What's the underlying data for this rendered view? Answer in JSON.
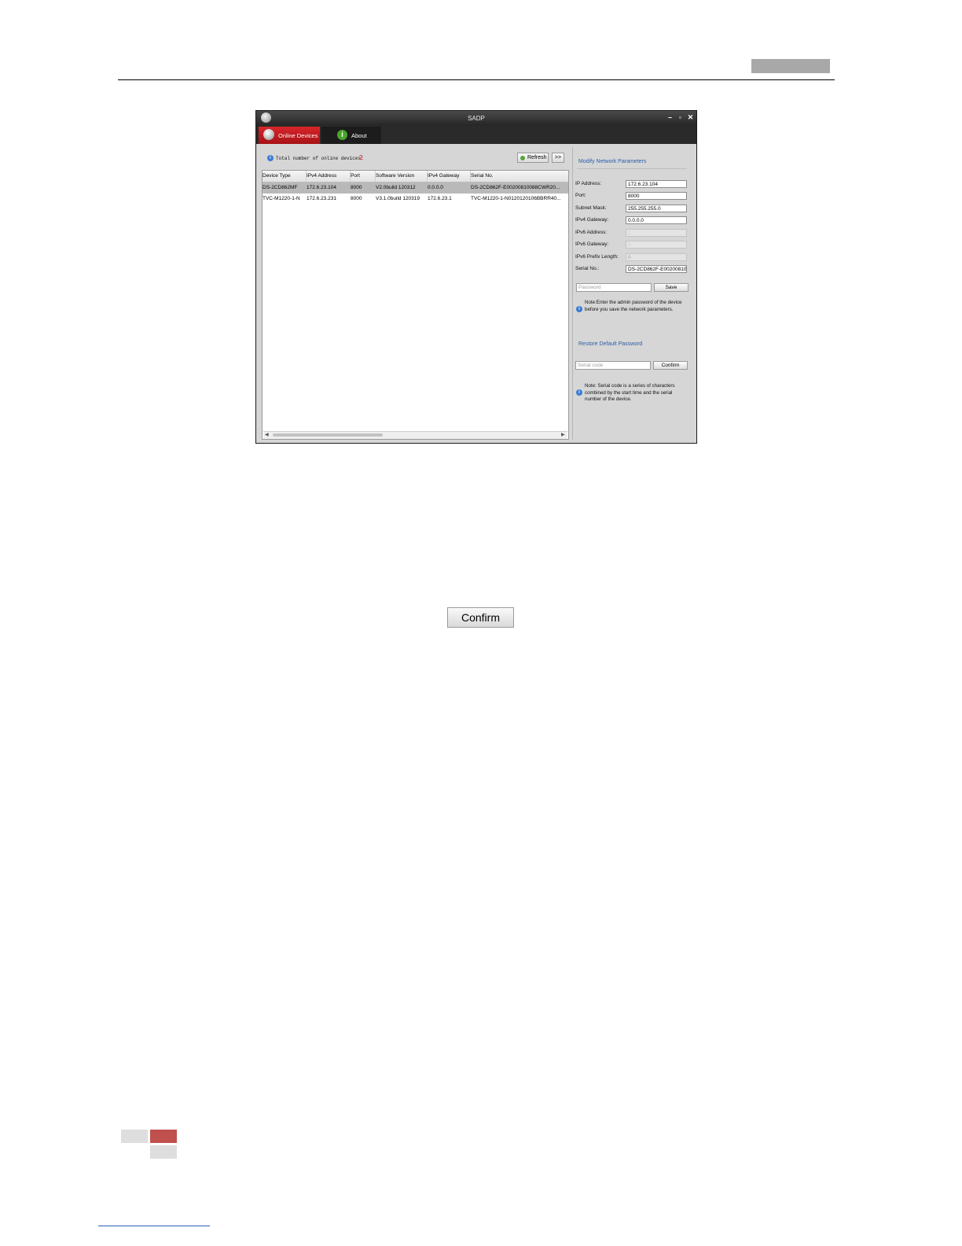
{
  "window": {
    "title": "SADP",
    "tabs": [
      "Online Devices",
      "About"
    ]
  },
  "device_list": {
    "total_label": "Total number of online devices:",
    "total_count": "2",
    "refresh_label": "Refresh",
    "expand_label": ">>",
    "columns": [
      "Device Type",
      "IPv4 Address",
      "Port",
      "Software Version",
      "IPv4 Gateway",
      "Serial No."
    ],
    "rows": [
      [
        "DS-2CD862MF",
        "172.6.23.104",
        "8000",
        "V2.0build 120312",
        "0.0.0.0",
        "DS-2CD862F-E00200810088CWR20..."
      ],
      [
        "TVC-M1220-1-N",
        "172.6.23.231",
        "8000",
        "V3.1.0build 120319",
        "172.6.23.1",
        "TVC-M1220-1-N0120120106BBRR40..."
      ]
    ]
  },
  "network_params": {
    "title": "Modify Network Parameters",
    "fields": [
      {
        "label": "IP Address:",
        "value": "172.6.23.104"
      },
      {
        "label": "Port:",
        "value": "8000"
      },
      {
        "label": "Subnet Mask:",
        "value": "255.255.255.0"
      },
      {
        "label": "IPv4 Gateway:",
        "value": "0.0.0.0"
      },
      {
        "label": "IPv6 Address:",
        "value": "::"
      },
      {
        "label": "IPv6 Gateway:",
        "value": "::"
      },
      {
        "label": "IPv6 Prefix Length:",
        "value": "0"
      },
      {
        "label": "Serial No.:",
        "value": "DS-2CD862F-E00200810"
      }
    ],
    "password_placeholder": "Password",
    "save_label": "Save",
    "note_password": "Note:Enter the admin password of the device before you save the network parameters.",
    "restore_title": "Restore Default Password",
    "serial_placeholder": "Serial code",
    "confirm_label": "Confirm",
    "note_serial": "Note: Serial code is a series of characters combined by the start time and the serial number of the device."
  },
  "confirm_button_label": "Confirm",
  "colors": {
    "accent_red": "#d21b1b",
    "link_blue": "#2d5fa8",
    "footer_red": "#c0504d"
  }
}
